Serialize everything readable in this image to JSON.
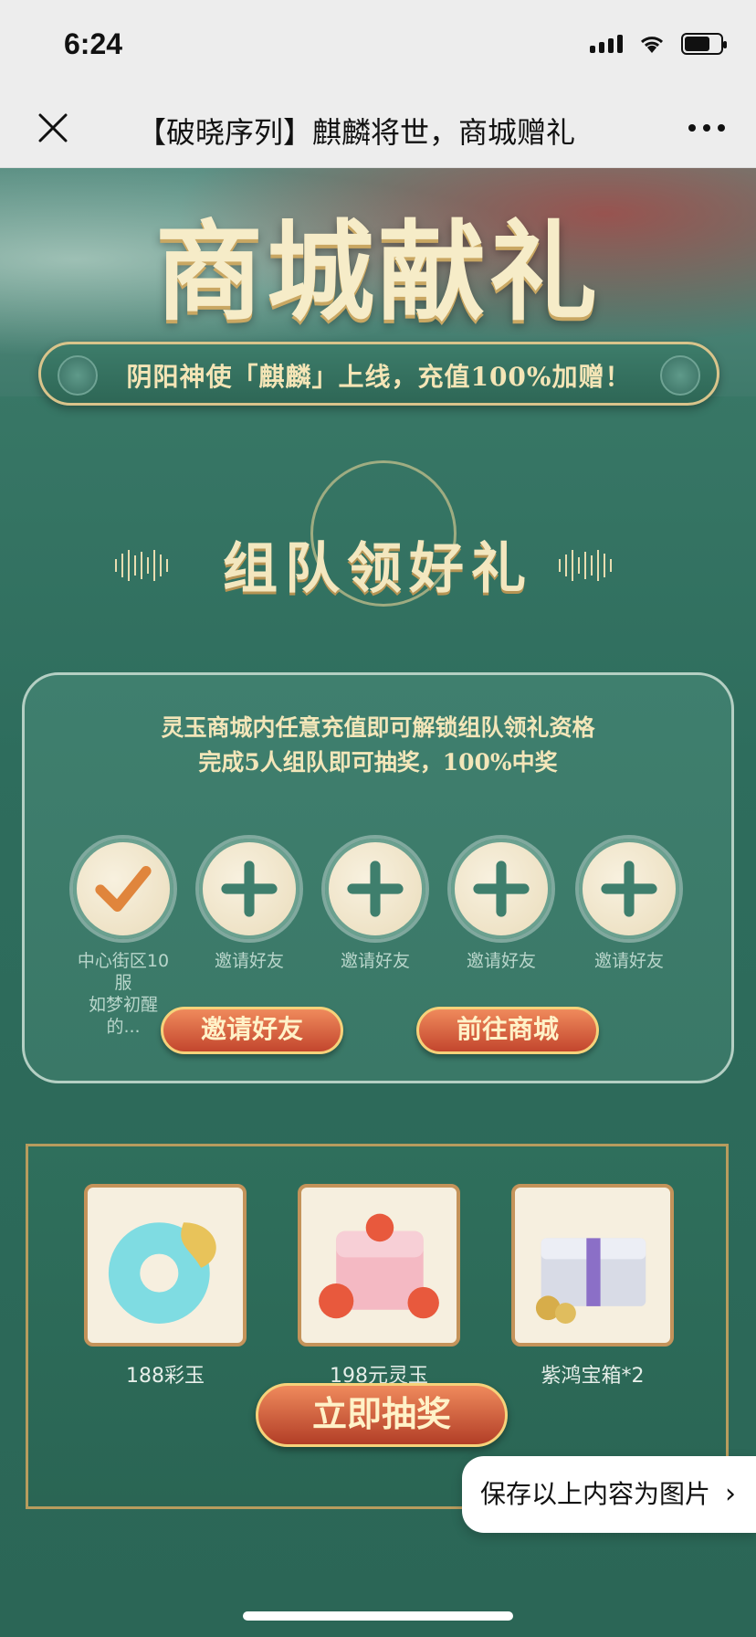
{
  "status_bar": {
    "time": "6:24"
  },
  "nav": {
    "title": "【破晓序列】麒麟将世，商城赠礼"
  },
  "hero": {
    "title": "商城献礼",
    "banner_text": "阴阳神使「麒麟」上线，充值100%加赠！"
  },
  "team_section": {
    "heading": "组队领好礼",
    "line1": "灵玉商城内任意充值即可解锁组队领礼资格",
    "line2": "完成5人组队即可抽奖，100%中奖",
    "slots": [
      {
        "label": "中心街区10服\n如梦初醒的...",
        "icon": "check-icon"
      },
      {
        "label": "邀请好友",
        "icon": "plus-icon"
      },
      {
        "label": "邀请好友",
        "icon": "plus-icon"
      },
      {
        "label": "邀请好友",
        "icon": "plus-icon"
      },
      {
        "label": "邀请好友",
        "icon": "plus-icon"
      }
    ],
    "invite_button": "邀请好友",
    "shop_button": "前往商城"
  },
  "prizes": {
    "items": [
      {
        "label": "188彩玉",
        "icon": "jade-icon"
      },
      {
        "label": "198元灵玉",
        "icon": "lingyu-pack-icon"
      },
      {
        "label": "紫鸿宝箱*2",
        "icon": "treasure-chest-icon"
      }
    ],
    "draw_button": "立即抽奖"
  },
  "toast": {
    "save_text": "保存以上内容为图片"
  },
  "colors": {
    "accent_gold": "#f3e7bf",
    "button_red": "#c3462e",
    "bg_green": "#2f6b5c"
  }
}
